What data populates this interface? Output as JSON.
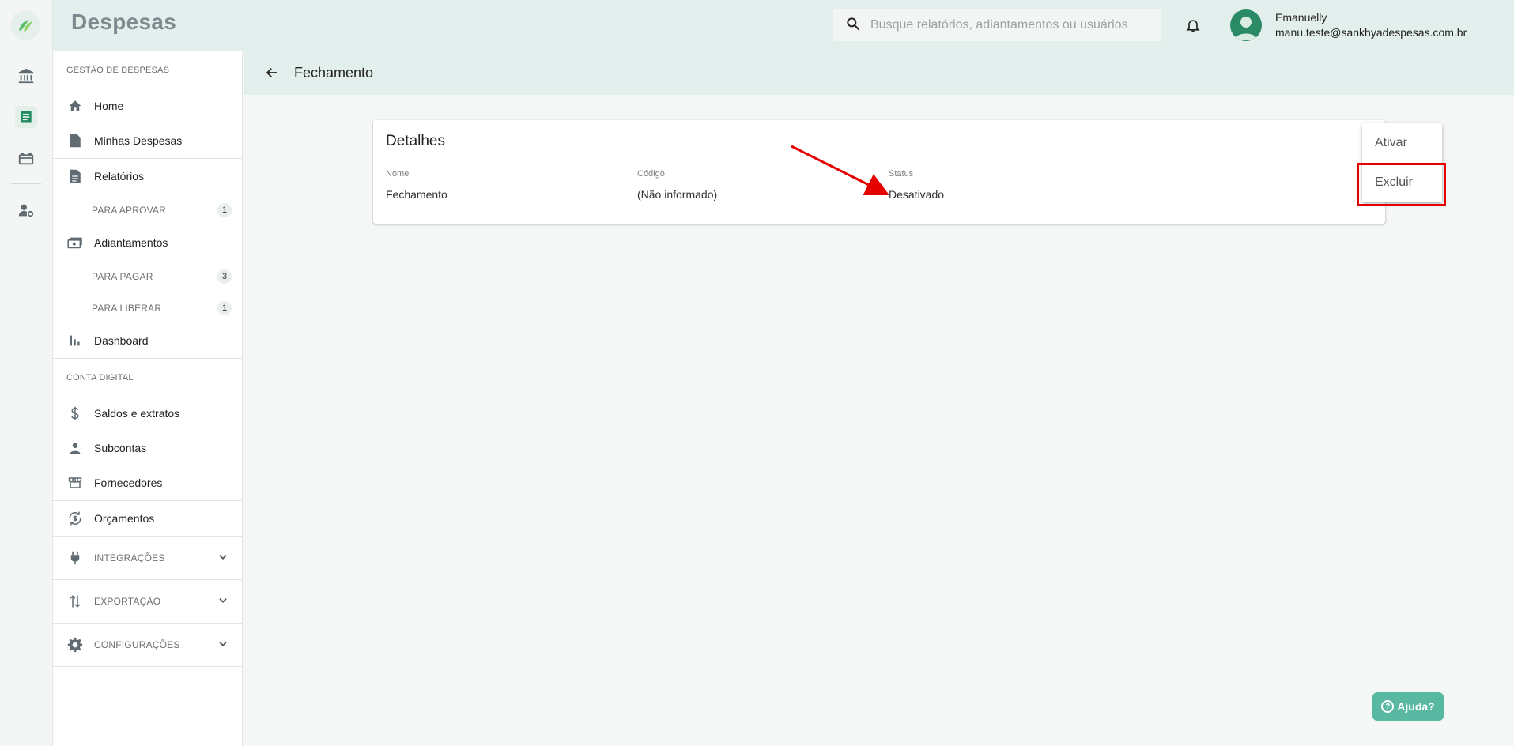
{
  "header": {
    "app_title": "Despesas",
    "search_placeholder": "Busque relatórios, adiantamentos ou usuários",
    "user_name": "Emanuelly",
    "user_email": "manu.teste@sankhyadespesas.com.br"
  },
  "sidebar": {
    "section_gestao": "GESTÃO DE DESPESAS",
    "home": "Home",
    "minhas_despesas": "Minhas Despesas",
    "relatorios": "Relatórios",
    "para_aprovar": "PARA APROVAR",
    "para_aprovar_count": "1",
    "adiantamentos": "Adiantamentos",
    "para_pagar": "PARA PAGAR",
    "para_pagar_count": "3",
    "para_liberar": "PARA LIBERAR",
    "para_liberar_count": "1",
    "dashboard": "Dashboard",
    "section_conta": "CONTA DIGITAL",
    "saldos": "Saldos e extratos",
    "subcontas": "Subcontas",
    "fornecedores": "Fornecedores",
    "orcamentos": "Orçamentos",
    "integracoes": "INTEGRAÇÕES",
    "exportacao": "EXPORTAÇÃO",
    "configuracoes": "CONFIGURAÇÕES"
  },
  "page": {
    "title": "Fechamento"
  },
  "details": {
    "title": "Detalhes",
    "nome_label": "Nome",
    "nome_value": "Fechamento",
    "codigo_label": "Código",
    "codigo_value": "(Não informado)",
    "status_label": "Status",
    "status_value": "Desativado"
  },
  "menu": {
    "ativar": "Ativar",
    "excluir": "Excluir"
  },
  "help": {
    "label": "Ajuda?"
  },
  "colors": {
    "brand_green": "#2a8a66",
    "header_bg": "#e3efec",
    "highlight_red": "#e50000",
    "help_button": "#58b8a1"
  }
}
